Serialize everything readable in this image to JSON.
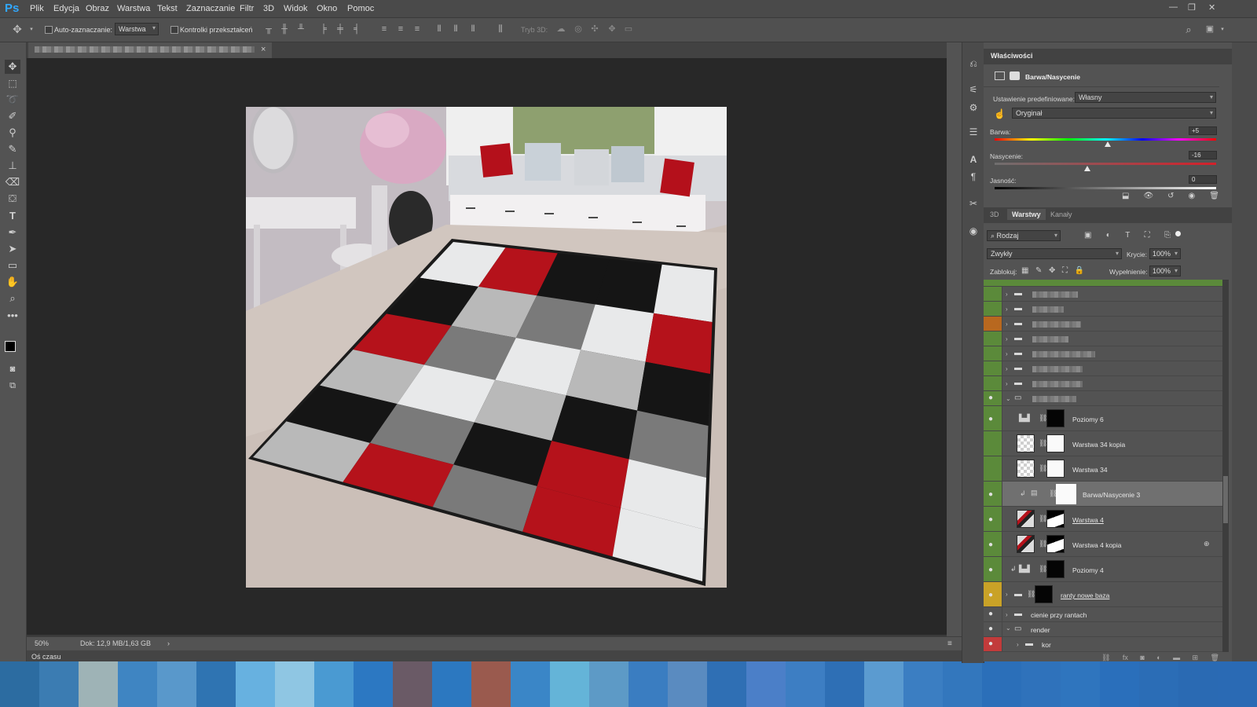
{
  "app": {
    "logo": "Ps"
  },
  "menu": [
    "Plik",
    "Edycja",
    "Obraz",
    "Warstwa",
    "Tekst",
    "Zaznaczanie",
    "Filtr",
    "3D",
    "Widok",
    "Okno",
    "Pomoc"
  ],
  "window_controls": {
    "minimize": "—",
    "restore": "❐",
    "close": "✕"
  },
  "options_bar": {
    "auto_select_label": "Auto-zaznaczanie:",
    "auto_select_value": "Warstwa",
    "transform_controls_label": "Kontrolki przekształceń",
    "mode_3d_label": "Tryb 3D:"
  },
  "document": {
    "tab_close": "×",
    "zoom": "50%",
    "doc_info": "Dok: 12,9 MB/1,63 GB",
    "status_arrow": "›"
  },
  "timeline": {
    "label": "Oś czasu"
  },
  "properties": {
    "panel_title": "Właściwości",
    "adjustment_name": "Barwa/Nasycenie",
    "preset_label": "Ustawienie predefiniowane:",
    "preset_value": "Własny",
    "channel_value": "Oryginał",
    "hue_label": "Barwa:",
    "hue_value": "+5",
    "hue_position": 0.51,
    "saturation_label": "Nasycenie:",
    "saturation_value": "-16",
    "saturation_position": 0.42,
    "lightness_label": "Jasność:",
    "lightness_value": "0"
  },
  "layers_panel": {
    "tabs": [
      "3D",
      "Warstwy",
      "Kanały"
    ],
    "active_tab": "Warstwy",
    "filter_label": "Rodzaj",
    "blend_mode": "Zwykły",
    "opacity_label": "Krycie:",
    "opacity_value": "100%",
    "lock_label": "Zablokuj:",
    "fill_label": "Wypełnienie:",
    "fill_value": "100%",
    "layers": [
      {
        "name": "Poziomy 6",
        "type": "adjustment-levels",
        "visible": true
      },
      {
        "name": "Warstwa 34 kopia",
        "type": "pixel-with-mask",
        "visible": false
      },
      {
        "name": "Warstwa 34",
        "type": "pixel-with-mask",
        "visible": false
      },
      {
        "name": "Barwa/Nasycenie 3",
        "type": "adjustment-hue",
        "visible": true,
        "selected": true
      },
      {
        "name": "Warstwa 4",
        "type": "pixel-with-mask",
        "visible": true
      },
      {
        "name": "Warstwa 4 kopia",
        "type": "pixel-with-mask",
        "visible": true
      },
      {
        "name": "Poziomy 4",
        "type": "adjustment-levels",
        "visible": true
      },
      {
        "name": "ranty nowe baza",
        "type": "group-with-mask",
        "visible": true
      },
      {
        "name": "cienie przy rantach",
        "type": "group",
        "visible": true
      },
      {
        "name": "render",
        "type": "group",
        "visible": true
      },
      {
        "name": "kor",
        "type": "group",
        "visible": true
      }
    ]
  },
  "colors": {
    "accent_blue": "#31a8ff",
    "label_green": "#5b8a3a",
    "label_orange": "#b8681f",
    "label_yellow": "#c9a227",
    "label_red": "#c23b3b",
    "rug_red": "#b5121b"
  }
}
